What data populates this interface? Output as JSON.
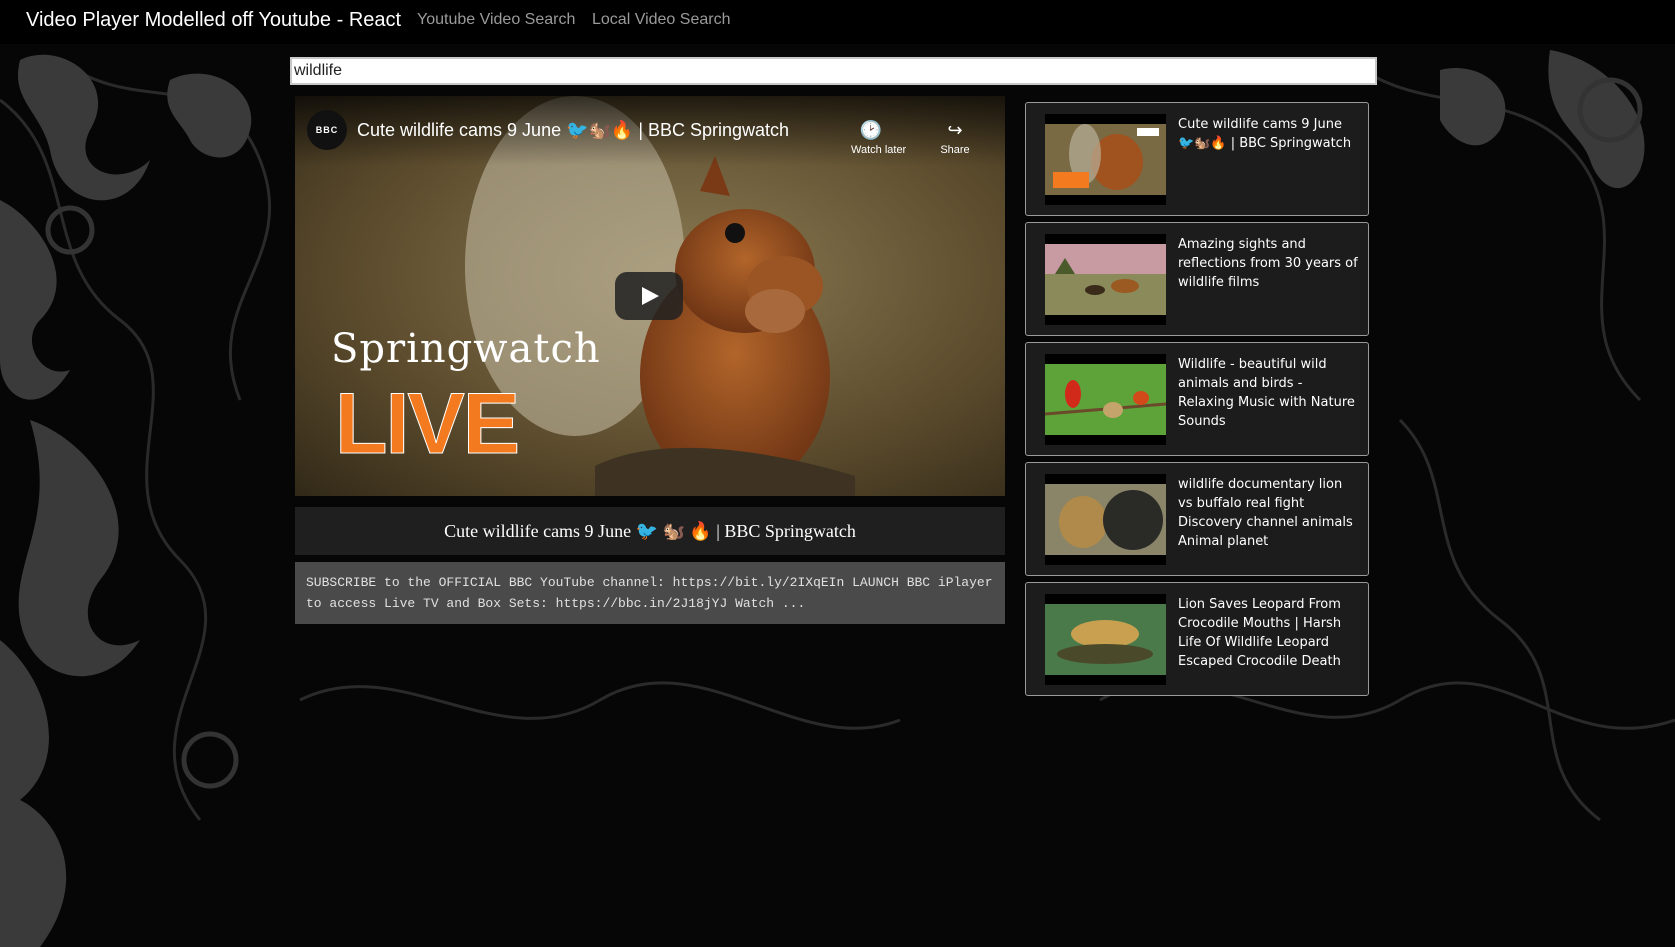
{
  "navbar": {
    "brand": "Video Player Modelled off Youtube - React",
    "links": [
      "Youtube Video Search",
      "Local Video Search"
    ]
  },
  "search": {
    "value": "wildlife"
  },
  "player": {
    "channel": "BBC",
    "title": "Cute wildlife cams 9 June 🐦🐿️🔥 | BBC Springwatch",
    "watch_later": "Watch later",
    "share": "Share",
    "overlay_brand": "Springwatch",
    "overlay_live": "LIVE"
  },
  "selected_video": {
    "title": "Cute wildlife cams 9 June 🐦 🐿️ 🔥 | BBC Springwatch",
    "description": "SUBSCRIBE to the OFFICIAL BBC YouTube channel: https://bit.ly/2IXqEIn LAUNCH BBC iPlayer to access Live TV and Box Sets: https://bbc.in/2J18jYJ Watch ..."
  },
  "video_list": [
    {
      "title": "Cute wildlife cams 9 June 🐦🐿️🔥 | BBC Springwatch",
      "thumb_icon": "squirrel-thumbnail"
    },
    {
      "title": "Amazing sights and reflections from 30 years of wildlife films",
      "thumb_icon": "savanna-thumbnail"
    },
    {
      "title": "Wildlife - beautiful wild animals and birds - Relaxing Music with Nature Sounds",
      "thumb_icon": "birds-thumbnail"
    },
    {
      "title": "wildlife documentary lion vs buffalo real fight Discovery channel animals Animal planet",
      "thumb_icon": "lion-buffalo-thumbnail"
    },
    {
      "title": "Lion Saves Leopard From Crocodile Mouths | Harsh Life Of Wildlife Leopard Escaped Crocodile Death",
      "thumb_icon": "leopard-crocodile-thumbnail"
    }
  ],
  "colors": {
    "navbar": "#000000",
    "list_item_bg": "#1c1c1c",
    "description_bg": "#4a4a4a",
    "live_orange": "#f47a1f"
  }
}
